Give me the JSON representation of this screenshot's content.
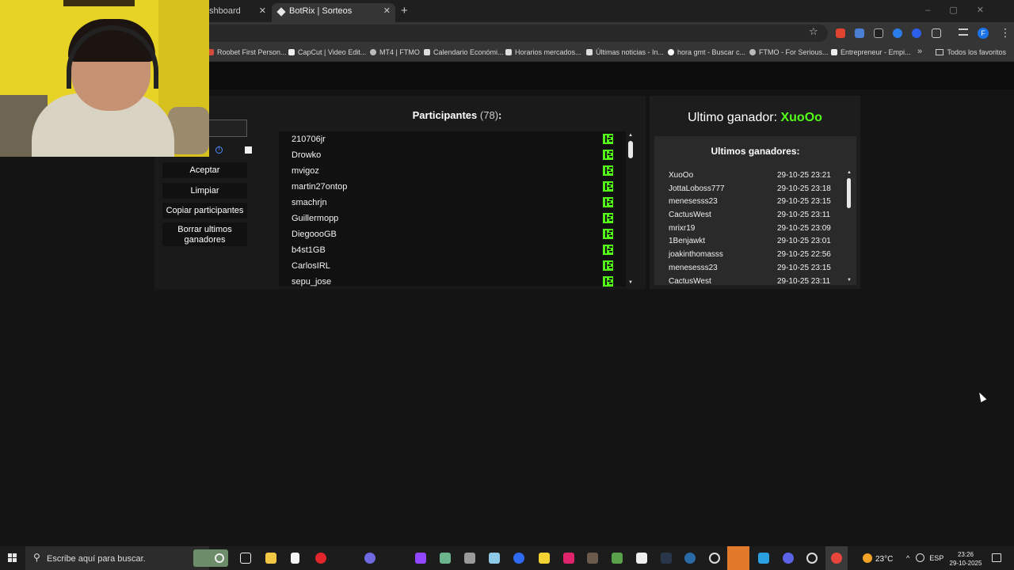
{
  "browser": {
    "tabs": [
      {
        "title": "shboard"
      },
      {
        "title": "BotRix | Sorteos"
      }
    ],
    "new_tab": "+",
    "bookmarks": [
      {
        "label": "Roobet First Person..."
      },
      {
        "label": "CapCut | Video Edit..."
      },
      {
        "label": "MT4 | FTMO"
      },
      {
        "label": "Calendario Económi..."
      },
      {
        "label": "Horarios mercados..."
      },
      {
        "label": "Últimas noticias - In..."
      },
      {
        "label": "hora gmt - Buscar c..."
      },
      {
        "label": "FTMO - For Serious..."
      },
      {
        "label": "Entrepreneur - Empi..."
      }
    ],
    "bookmarks_more": "»",
    "bookmarks_folder": "Todos los favoritos",
    "profile_initial": "F"
  },
  "controls": {
    "accept_label": "Aceptar",
    "clear_label": "Limpiar",
    "copy_label": "Copiar participantes",
    "delete_label": "Borrar ultimos ganadores"
  },
  "participants": {
    "title": "Participantes",
    "count": "(78)",
    "colon": ":",
    "names": [
      "210706jr",
      "Drowko",
      "mvigoz",
      "martin27ontop",
      "smachrjn",
      "Guillermopp",
      "DiegoooGB",
      "b4st1GB",
      "CarlosIRL",
      "sepu_jose"
    ]
  },
  "last_winner": {
    "label": "Ultimo ganador:",
    "name": "XuoOo"
  },
  "recent_winners": {
    "title": "Ultimos ganadores:",
    "rows": [
      {
        "name": "XuoOo",
        "date": "29-10-25 23:21"
      },
      {
        "name": "JottaLoboss777",
        "date": "29-10-25 23:18"
      },
      {
        "name": "menesesss23",
        "date": "29-10-25 23:15"
      },
      {
        "name": "CactusWest",
        "date": "29-10-25 23:11"
      },
      {
        "name": "mrixr19",
        "date": "29-10-25 23:09"
      },
      {
        "name": "1Benjawkt",
        "date": "29-10-25 23:01"
      },
      {
        "name": "joakinthomasss",
        "date": "29-10-25 22:56"
      },
      {
        "name": "menesesss23",
        "date": "29-10-25 23:15"
      },
      {
        "name": "CactusWest",
        "date": "29-10-25 23:11"
      }
    ]
  },
  "taskbar": {
    "search_placeholder": "Escribe aquí para buscar.",
    "temperature": "23°C",
    "language": "ESP",
    "time": "23:26",
    "date": "29-10-2025"
  },
  "colors": {
    "accent_green": "#53fc18",
    "page_bg": "#141414"
  }
}
